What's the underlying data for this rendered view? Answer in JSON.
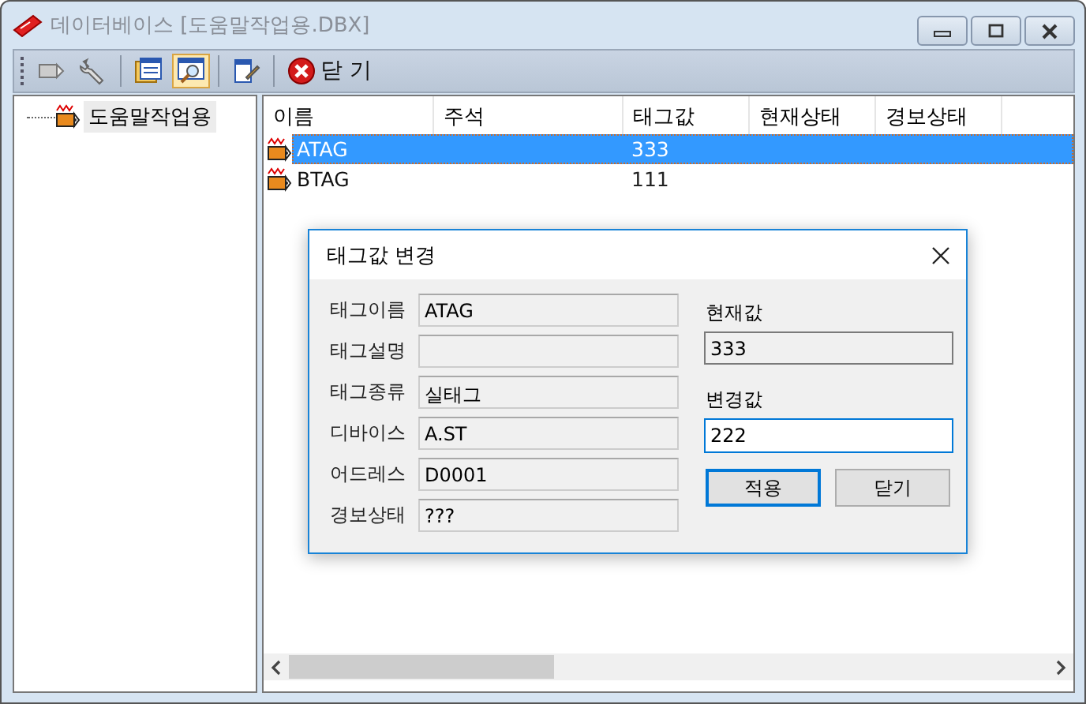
{
  "window": {
    "title": "데이터베이스 [도움말작업용.DBX]",
    "active": false
  },
  "toolbar": [
    {
      "kind": "tag",
      "pressed": false
    },
    {
      "kind": "tool",
      "pressed": false
    },
    {
      "kind": "sep"
    },
    {
      "kind": "list",
      "pressed": false
    },
    {
      "kind": "find",
      "pressed": true
    },
    {
      "kind": "sep"
    },
    {
      "kind": "edit",
      "pressed": false
    },
    {
      "kind": "sep"
    },
    {
      "kind": "close",
      "pressed": false,
      "label": "닫 기"
    }
  ],
  "tree": {
    "items": [
      {
        "label": "도움말작업용",
        "selected": true
      }
    ]
  },
  "table": {
    "columns": [
      "이름",
      "주석",
      "태그값",
      "현재상태",
      "경보상태"
    ],
    "rows": [
      {
        "name": "ATAG",
        "value": "333",
        "selected": true
      },
      {
        "name": "BTAG",
        "value": "111",
        "selected": false
      }
    ]
  },
  "dialog": {
    "title": "태그값 변경",
    "fields": [
      {
        "label": "태그이름",
        "value": "ATAG"
      },
      {
        "label": "태그설명"
      },
      {
        "label": "태그종류",
        "value": "실태그"
      },
      {
        "label": "디바이스",
        "value": "A.ST"
      },
      {
        "label": "어드레스",
        "value": "D0001"
      },
      {
        "label": "경보상태",
        "value": "???"
      }
    ],
    "current": {
      "label": "현재값",
      "value": "333"
    },
    "new": {
      "label": "변경값",
      "value": "222"
    },
    "buttons": [
      {
        "label": "적용",
        "default": true
      },
      {
        "label": "닫기",
        "default": false
      }
    ]
  }
}
